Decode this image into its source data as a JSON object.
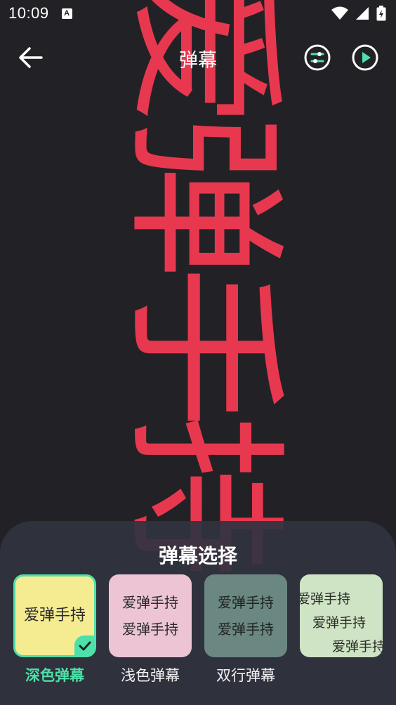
{
  "status_bar": {
    "time": "10:09",
    "notification_icon": "a-icon",
    "right_icons": [
      "wifi-icon",
      "signal-icon",
      "battery-icon"
    ]
  },
  "app_bar": {
    "title": "弹幕",
    "back_icon": "arrow-left-icon",
    "settings_icon": "sliders-icon",
    "play_icon": "play-circle-icon"
  },
  "danmaku": {
    "text": "爱弹手持",
    "color": "#e8384f"
  },
  "panel": {
    "title": "弹幕选择",
    "accent_color": "#4de0a8",
    "options": [
      {
        "label": "深色弹幕",
        "preview": [
          "爱弹手持"
        ],
        "selected": true
      },
      {
        "label": "浅色弹幕",
        "preview": [
          "爱弹手持",
          "爱弹手持"
        ],
        "selected": false
      },
      {
        "label": "双行弹幕",
        "preview": [
          "爱弹手持",
          "爱弹手持"
        ],
        "selected": false
      },
      {
        "label": "",
        "preview": [
          "爱弹手持",
          "爱弹手持",
          "爱弹手持"
        ],
        "selected": false
      }
    ]
  }
}
